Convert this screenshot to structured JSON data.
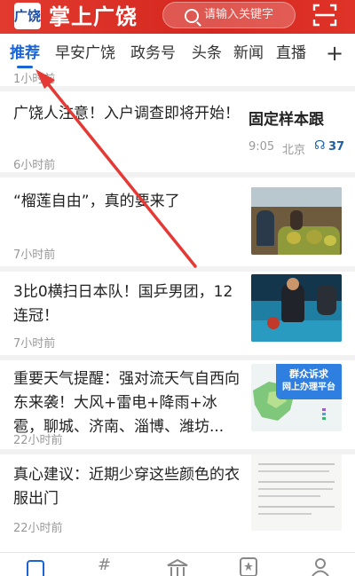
{
  "header": {
    "logo_text": "广饶",
    "brand": "掌上广饶",
    "search_placeholder": "请输入关键字"
  },
  "tabs": [
    {
      "label": "推荐",
      "active": true
    },
    {
      "label": "早安广饶"
    },
    {
      "label": "政务号"
    },
    {
      "label": "头条"
    },
    {
      "label": "新闻"
    },
    {
      "label": "直播"
    }
  ],
  "colors": {
    "brand_red": "#d4271f",
    "accent_blue": "#1a64d6",
    "arrow": "#e53935"
  },
  "feed": {
    "partial_time": "1小时前",
    "items": [
      {
        "title": "广饶人注意！入户调查即将开始！",
        "time": "6小时前",
        "thumb_side_text": {
          "title": "固定样本跟",
          "time": "9:05",
          "place": "北京",
          "listens": "37"
        }
      },
      {
        "title": "“榴莲自由”，真的要来了",
        "time": "7小时前"
      },
      {
        "title": "3比0横扫日本队！国乒男团，12连冠！",
        "time": "7小时前"
      },
      {
        "title": "重要天气提醒：强对流天气自西向东来袭！大风+雷电+降雨+冰雹，聊城、济南、淄博、潍坊...",
        "time": "22小时前",
        "banner": {
          "line1": "群众诉求",
          "line2": "网上办理平台"
        }
      },
      {
        "title": "真心建议：近期少穿这些颜色的衣服出门",
        "time": "22小时前"
      }
    ]
  },
  "bottom_nav": [
    {
      "icon": "home-icon",
      "active": true
    },
    {
      "icon": "hashtag-icon"
    },
    {
      "icon": "government-icon"
    },
    {
      "icon": "star-icon"
    },
    {
      "icon": "user-icon"
    }
  ]
}
